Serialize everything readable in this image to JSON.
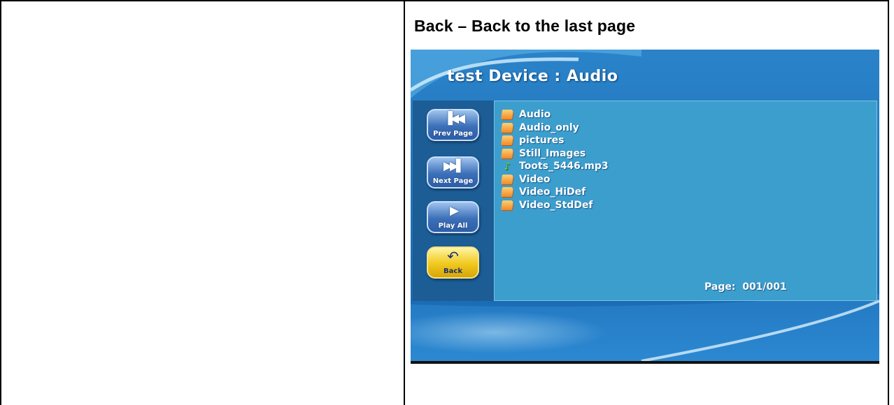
{
  "caption": "Back – Back to the last page",
  "screen": {
    "title": "test Device : Audio",
    "buttons": [
      {
        "label": "Prev Page",
        "glyph": "▐◀◀",
        "icon": "prev-page-icon"
      },
      {
        "label": "Next Page",
        "glyph": "▶▶▌",
        "icon": "next-page-icon"
      },
      {
        "label": "Play All",
        "glyph": "▶",
        "icon": "play-icon"
      },
      {
        "label": "Back",
        "glyph": "↶",
        "icon": "back-arrow-icon"
      }
    ],
    "files": [
      {
        "name": "Audio",
        "type": "folder"
      },
      {
        "name": "Audio_only",
        "type": "folder"
      },
      {
        "name": "pictures",
        "type": "folder"
      },
      {
        "name": "Still_Images",
        "type": "folder"
      },
      {
        "name": "Toots_5446.mp3",
        "type": "music"
      },
      {
        "name": "Video",
        "type": "folder"
      },
      {
        "name": "Video_HiDef",
        "type": "folder"
      },
      {
        "name": "Video_StdDef",
        "type": "folder"
      }
    ],
    "page_label": "Page:",
    "page_value": "001/001"
  },
  "colors": {
    "screen_blue": "#1f6fb6",
    "list_panel": "#3c9ecd",
    "side_panel": "#1c5d95",
    "back_button": "#f1c81d"
  }
}
